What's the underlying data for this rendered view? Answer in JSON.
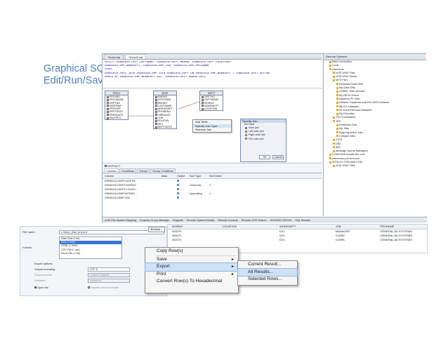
{
  "slide": {
    "title_line1": "Graphical SQL",
    "title_line2": "Edit/Run/Save"
  },
  "editor": {
    "tabs": [
      "*Script.sql",
      "*Script2.sql"
    ],
    "sql_lines": [
      "SELECT DSN81010.DEPT.DEPTNAME, DSN81010.DEPT.MGRNO, DSN81010.DEPT.LOCATION,",
      "  DSN81010.EMP.WORKDEPT, DSN81010.EMP.JOB, DSN81010.EMP.PROJNAME",
      "FROM",
      "    DSN81010.PROJ JOIN DSN81010.EMP JOIN DSN81010.DEPT ON DSN81010.EMP.WORKDEPT = DSN81010.DEPT.DEPTNO",
      "  ORDER BY DSN81010.EMP.WORKDEPT ASC, DSN81010.DEPT.MGRNO DESC"
    ],
    "tables": [
      {
        "name": "PROJ",
        "cols": [
          "PROJNO",
          "PROJNAME",
          "DEPTNO",
          "RESPEMP",
          "PRSTAFF",
          "PRSTDATE",
          "PRENDATE",
          "MAJPROJ"
        ]
      },
      {
        "name": "EMP",
        "cols": [
          "EMPNO",
          "FIRSTNME",
          "MIDINIT",
          "LASTNAME",
          "WORKDEPT",
          "PHONENO",
          "HIREDATE",
          "JOB",
          "EDLEVEL",
          "SEX",
          "BIRTHDATE"
        ]
      },
      {
        "name": "DEPT",
        "cols": [
          "DEPTNO",
          "DEPTNAME",
          "MGRNO",
          "ADMRDEPT",
          "LOCATION"
        ]
      }
    ],
    "context_menu": [
      "Add Table...",
      "Specify Join Type...",
      "Remove Join"
    ],
    "dialog": {
      "title": "Specify Join",
      "label": "Join Type",
      "options": [
        "Inner join",
        "Left outer join",
        "Right outer join",
        "Full outer join"
      ],
      "ok": "OK",
      "cancel": "Cancel"
    },
    "distinct_label": "DISTINCT",
    "subtabs": [
      "Columns",
      "Conditions",
      "Groups",
      "Group Conditions"
    ],
    "columns_header": [
      "Column",
      "Alias",
      "Output",
      "Sort Type",
      "Sort Order"
    ],
    "columns_rows": [
      [
        "DSN81010.DEPT.DEPTN...",
        "",
        "",
        "",
        ""
      ],
      [
        "DSN81010.DEPT.MGRNO",
        "",
        "",
        "Descendi...",
        "2"
      ],
      [
        "DSN81010.DEPT.LOCATI...",
        "",
        "",
        "",
        ""
      ],
      [
        "DSN81010.EMP.WORKD...",
        "",
        "",
        "Ascending",
        "1"
      ],
      [
        "DSN81010.EMP.JOB",
        "",
        "",
        "",
        ""
      ]
    ]
  },
  "status_tabs": [
    "z/OS File System Mapping",
    "Property Group Manager",
    "Snippets",
    "Remote System Details",
    "Remote Console",
    "Remote z/OS Search",
    "DDS0001.PATINS",
    "SQL Results"
  ],
  "remote_systems": {
    "title": "Remote Systems",
    "items": [
      "New Connection",
      "Local",
      "zserveros",
      "z/OS UNIX Files",
      "z/OS UNIX Shells",
      "MVS Files",
      "Retrieved Data Sets",
      "My Data Sets",
      "COBOL Test Libraries",
      "My REXX Execs",
      "Systems PF Files",
      "Division Copybook and DCLGEN Libraries",
      "My ICL Datasets",
      "All zUnit Files and Datasets",
      "My Favorites",
      "TSO Commands",
      "JES",
      "Retrieved Jobs",
      "My Jobs",
      "Sysprog Active Jobs",
      "Compile Jobs",
      "CICS",
      "DB2",
      "IMS",
      "Message Queue Managers",
      "CTIMVS08.torolab.ibm.com",
      "demomvs.pok.ibm.com",
      "WTSC47.ITSO.IBM.COM",
      "z/OS UNIX Files"
    ]
  },
  "export": {
    "file_name_label": "File name:",
    "file_name_value": "c:\\temp_dept_proj.xml",
    "browse_label": "Browse...",
    "format_label": "Format:",
    "formats": [
      "Plain Text (*.txt)",
      "XML (*.xml)",
      "HTML (*.html)",
      "CSV File (*.csv)",
      "Excel File (*.xls)"
    ],
    "selected_format": "XML (*.xml)",
    "options_label": "Export options",
    "output_encoding_label": "Output encoding:",
    "output_encoding_value": "UTF-8",
    "output_format_label": "Output format:",
    "output_format_value": "Column-Aligned",
    "delimiter_label": "Delimiter:",
    "delimiter_value": "<column>",
    "open_file_label": "Open file",
    "include_header_label": "Include column header"
  },
  "results": {
    "headers": [
      "MGRNO",
      "LOCATION",
      "WORKDEPT",
      "JOB",
      "PRONAME"
    ],
    "rows": [
      [
        "000070",
        "",
        "D21",
        "MANAGER",
        "GENERAL AD SYSTEMS"
      ],
      [
        "000070",
        "",
        "D21",
        "CLERK",
        "GENERAL AD SYSTEMS"
      ],
      [
        "000070",
        "",
        "D21",
        "CLERK",
        "GENERAL AD SYSTEMS"
      ]
    ]
  },
  "menu": {
    "items": [
      "Copy Row(s)",
      "Save",
      "Export",
      "Print",
      "Convert Row(s) To Hexadecimal"
    ],
    "submenu": [
      "Current Result...",
      "All Results...",
      "Selected Rows..."
    ]
  },
  "colors": {
    "title": "#4f81bd",
    "selection": "#3875d7",
    "menu_highlight": "#cfe2f6"
  }
}
